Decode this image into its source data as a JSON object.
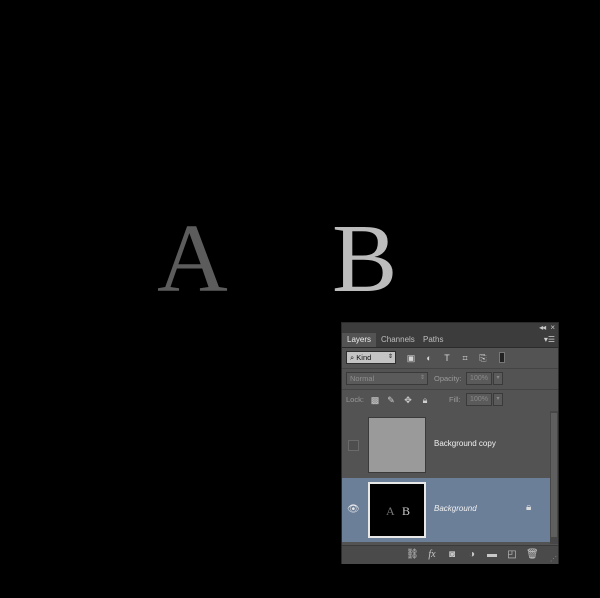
{
  "canvas": {
    "letter_a": "A",
    "letter_b": "B"
  },
  "panel": {
    "collapse_label": "◂◂",
    "close_label": "×",
    "menu_icon": "panel-menu-icon",
    "tabs": [
      "Layers",
      "Channels",
      "Paths"
    ],
    "active_tab": "Layers",
    "filter": {
      "label": "Kind",
      "icons": [
        "image-filter-icon",
        "adjustment-filter-icon",
        "type-filter-icon",
        "shape-filter-icon",
        "smart-object-filter-icon"
      ]
    },
    "blend_mode": "Normal",
    "opacity": {
      "label": "Opacity:",
      "value": "100%"
    },
    "fill": {
      "label": "Fill:",
      "value": "100%"
    },
    "lock": {
      "label": "Lock:",
      "icons": [
        "lock-transparent-icon",
        "lock-image-icon",
        "lock-position-icon",
        "lock-all-icon"
      ]
    },
    "layers": [
      {
        "name": "Background copy",
        "visible": false,
        "selected": false
      },
      {
        "name": "Background",
        "visible": true,
        "selected": true,
        "locked": true,
        "thumb_letters": [
          "A",
          "B"
        ]
      }
    ],
    "bottom_icons": [
      "link-icon",
      "fx-icon",
      "mask-icon",
      "adjustment-icon",
      "folder-icon",
      "new-layer-icon",
      "trash-icon"
    ],
    "fx_label": "fx"
  }
}
